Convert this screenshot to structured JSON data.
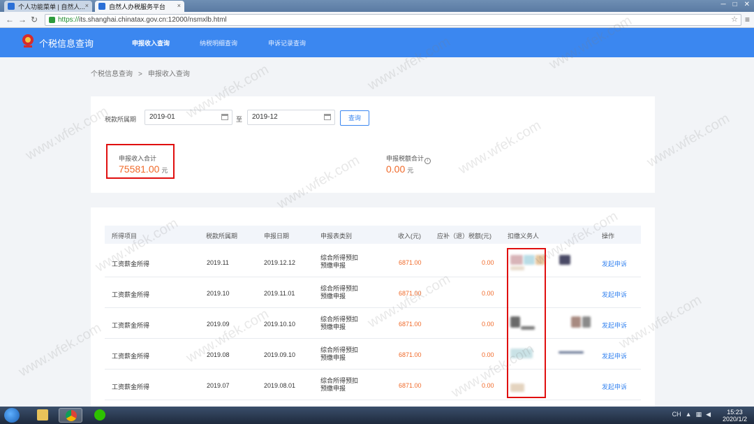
{
  "browser": {
    "tabs": [
      {
        "label": "个人功能菜单 | 自然人...",
        "active": false
      },
      {
        "label": "自然人办税服务平台",
        "active": true
      }
    ],
    "url_scheme": "https://",
    "url_rest": "its.shanghai.chinatax.gov.cn:12000/nsmxlb.html"
  },
  "app": {
    "title": "个税信息查询",
    "nav": [
      "申报收入查询",
      "纳税明细查询",
      "申诉记录查询"
    ],
    "nav_active": "申报收入查询",
    "color_primary": "#3b87f0",
    "color_accent": "#f06a2a"
  },
  "breadcrumb": {
    "parent": "个税信息查询",
    "separator": ">",
    "current": "申报收入查询"
  },
  "query": {
    "period_label": "税款所属期",
    "start": "2019-01",
    "to_label": "至",
    "end": "2019-12",
    "button": "查询"
  },
  "summary": {
    "income_label": "申报收入合计",
    "income_value": "75581.00",
    "tax_label": "申报税额合计",
    "tax_value": "0.00",
    "unit": "元"
  },
  "table": {
    "headers": [
      "所得项目",
      "税款所属期",
      "申报日期",
      "申报表类别",
      "收入(元)",
      "应补（退）税额(元)",
      "扣缴义务人",
      "操作"
    ],
    "rows": [
      {
        "item": "工资薪金所得",
        "period": "2019.11",
        "date": "2019.12.12",
        "type": "综合所得预扣预缴申报",
        "income": "6871.00",
        "tax": "0.00",
        "action": "发起申诉"
      },
      {
        "item": "工资薪金所得",
        "period": "2019.10",
        "date": "2019.11.01",
        "type": "综合所得预扣预缴申报",
        "income": "6871.00",
        "tax": "0.00",
        "action": "发起申诉"
      },
      {
        "item": "工资薪金所得",
        "period": "2019.09",
        "date": "2019.10.10",
        "type": "综合所得预扣预缴申报",
        "income": "6871.00",
        "tax": "0.00",
        "action": "发起申诉"
      },
      {
        "item": "工资薪金所得",
        "period": "2019.08",
        "date": "2019.09.10",
        "type": "综合所得预扣预缴申报",
        "income": "6871.00",
        "tax": "0.00",
        "action": "发起申诉"
      },
      {
        "item": "工资薪金所得",
        "period": "2019.07",
        "date": "2019.08.01",
        "type": "综合所得预扣预缴申报",
        "income": "6871.00",
        "tax": "0.00",
        "action": "发起申诉"
      }
    ]
  },
  "watermark": "www.wfek.com",
  "taskbar": {
    "time": "15:23",
    "date": "2020/1/2",
    "lang": "CH"
  }
}
